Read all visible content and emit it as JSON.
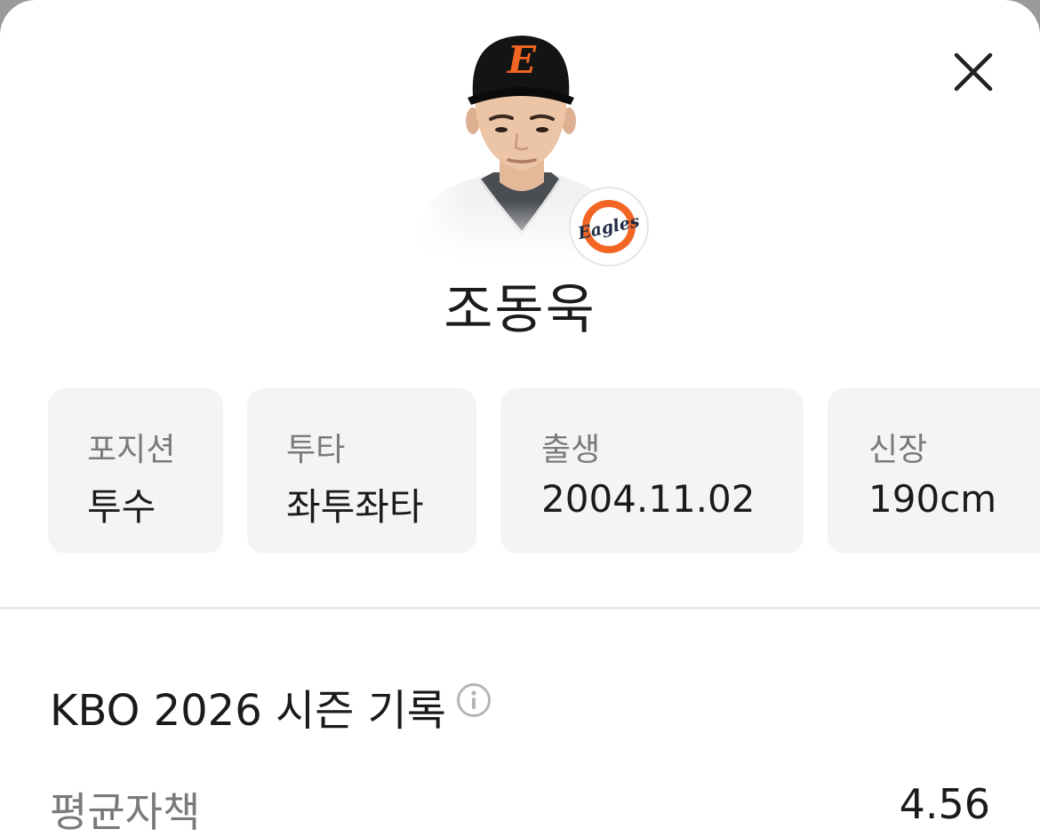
{
  "player": {
    "name": "조동욱"
  },
  "team": {
    "logo_text": "Eagles",
    "brand_color": "#F26522",
    "navy": "#1F2A44"
  },
  "info_cards": [
    {
      "label": "포지션",
      "value": "투수"
    },
    {
      "label": "투타",
      "value": "좌투좌타"
    },
    {
      "label": "출생",
      "value": "2004.11.02"
    },
    {
      "label": "신장",
      "value": "190cm"
    }
  ],
  "section": {
    "title": "KBO 2026 시즌 기록"
  },
  "stats": [
    {
      "label": "평균자책",
      "value": "4.56"
    }
  ],
  "icons": {
    "close": "close-icon",
    "info": "info-icon"
  }
}
